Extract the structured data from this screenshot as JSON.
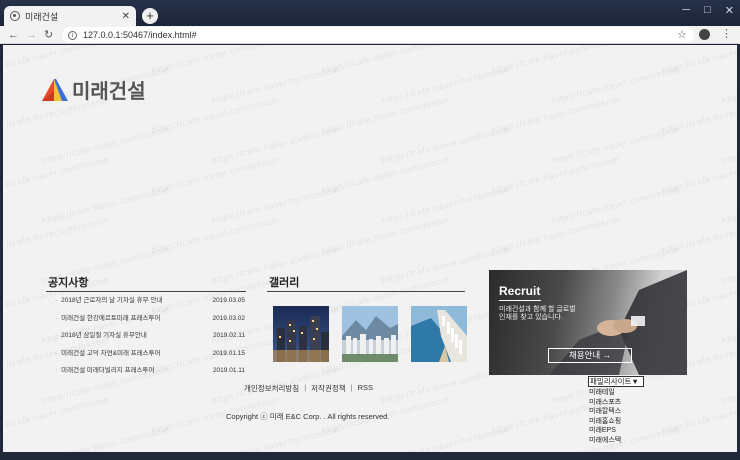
{
  "browser": {
    "tab_title": "미래건설",
    "url": "127.0.0.1:50467/index.html#",
    "window_controls": [
      "─",
      "□",
      "✕"
    ]
  },
  "watermark_text": "https://cafe.naver.com/ossom",
  "logo": {
    "text": "미래건설",
    "colors": {
      "red": "#e94a2c",
      "blue": "#3a6fd6",
      "yellow": "#f1c232"
    }
  },
  "notice": {
    "title": "공지사항",
    "items": [
      {
        "title": "2018년 근로자의 날 기자실 휴무 안내",
        "date": "2019.03.05"
      },
      {
        "title": "미래건설 한강에르토미래 프레스투어",
        "date": "2019.03.02"
      },
      {
        "title": "2018년 삼일절 기자실 휴무안내",
        "date": "2019.02.11"
      },
      {
        "title": "미래건설 고덕 자연&미래 프레스투어",
        "date": "2019.01.15"
      },
      {
        "title": "미래건설 미래더빌리지 프레스투어",
        "date": "2019.01.11"
      }
    ]
  },
  "gallery": {
    "title": "갤러리"
  },
  "recruit": {
    "title": "Recruit",
    "description": "미래건설과 함께 할 글로벌 인재를 찾고 있습니다.",
    "button_label": "채용안내 →"
  },
  "family_site": {
    "selected": "패밀리사이트▼",
    "options": [
      "미래테일",
      "미래스포츠",
      "미래칼텍스",
      "미래홈쇼핑",
      "미래EPS",
      "미래에스텍"
    ]
  },
  "footer": {
    "links": [
      "개인정보처리방침",
      "저작권정책",
      "RSS"
    ],
    "separator": "|",
    "copyright": "Copyright ⓒ 미래 E&C Corp. . All rights reserved."
  }
}
